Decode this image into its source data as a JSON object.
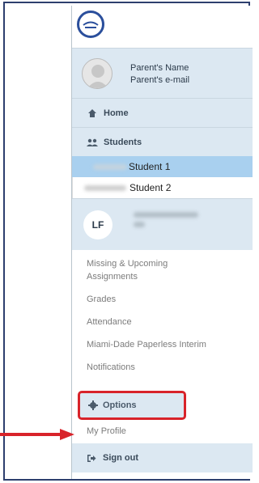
{
  "profile": {
    "name": "Parent's Name",
    "email": "Parent's e-mail"
  },
  "nav": {
    "home": "Home",
    "students": "Students",
    "student_1": "Student 1",
    "student_2": "Student 2"
  },
  "selected_student": {
    "initials": "LF"
  },
  "links": [
    "Missing & Upcoming",
    "Assignments",
    "Grades",
    "Attendance",
    "Miami-Dade Paperless Interim",
    "Notifications"
  ],
  "options": "Options",
  "my_profile": "My Profile",
  "sign_out": "Sign out",
  "colors": {
    "highlight": "#d8232a",
    "selected_student_bg": "#a9d0ef",
    "menu_row_bg": "#dce8f2",
    "logo": "#2b4f9c"
  }
}
